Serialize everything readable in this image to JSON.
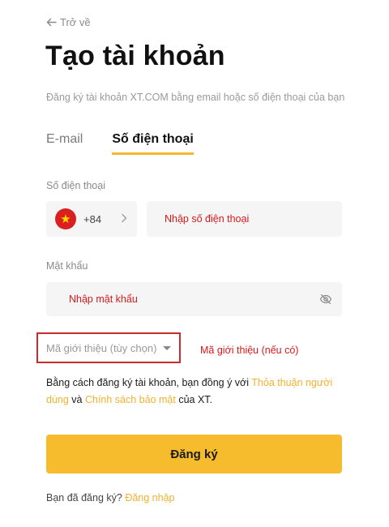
{
  "back": {
    "label": "Trở về"
  },
  "page": {
    "title": "Tạo tài khoản",
    "subtitle": "Đăng ký tài khoản XT.COM bằng email hoặc số điện thoại của bạn"
  },
  "tabs": [
    {
      "label": "E-mail",
      "active": false
    },
    {
      "label": "Số điện thoại",
      "active": true
    }
  ],
  "phone": {
    "label": "Số điện thoại",
    "country_code": "+84",
    "flag_symbol": "★",
    "placeholder": "Nhập số điện thoại"
  },
  "password": {
    "label": "Mật khẩu",
    "placeholder": "Nhập mật khẩu"
  },
  "referral": {
    "label": "Mã giới thiệu (tùy chọn)",
    "annotation": "Mã giới thiệu (nếu có)"
  },
  "terms": {
    "prefix": "Bằng cách đăng ký tài khoản, bạn đồng ý với ",
    "user_agreement": "Thỏa thuận người dùng",
    "and": " và ",
    "privacy_policy": "Chính sách bảo mật",
    "suffix": " của XT."
  },
  "submit": {
    "label": "Đăng ký"
  },
  "login": {
    "prompt": "Bạn đã đăng ký?",
    "link": "Đăng nhập"
  },
  "colors": {
    "accent": "#f7bb2e",
    "link": "#f0b22e",
    "annotation": "#d7191c",
    "flag": "#d9201f"
  }
}
